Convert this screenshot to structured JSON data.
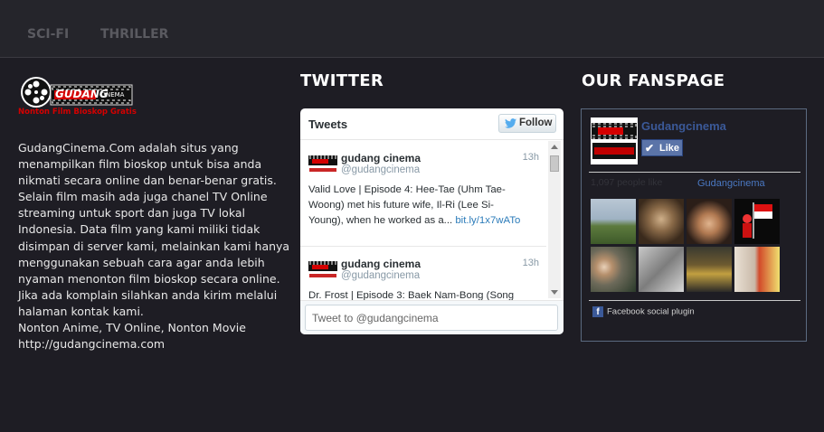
{
  "nav": {
    "items": [
      {
        "label": "SCI-FI"
      },
      {
        "label": "THRILLER"
      }
    ]
  },
  "logo": {
    "brand_text": "GUDANG CINEMA",
    "tagline": "Nonton Film Bioskop Gratis"
  },
  "about": {
    "lines": [
      "GudangCinema.Com adalah situs yang",
      "menampilkan film bioskop untuk bisa anda",
      "nikmati secara online dan benar-benar gratis.",
      "Selain film masih ada juga chanel TV Online",
      "streaming untuk sport dan juga TV lokal",
      "Indonesia. Data film yang kami miliki tidak",
      "disimpan di server kami, melainkan kami hanya",
      "menggunakan sebuah cara agar anda lebih",
      "nyaman menonton film bioskop secara online.",
      "Jika ada komplain silahkan anda kirim melalui",
      "halaman kontak kami.",
      "Nonton Anime, TV Online, Nonton Movie",
      "http://gudangcinema.com"
    ]
  },
  "twitter": {
    "heading": "TWITTER",
    "widget_title": "Tweets",
    "follow_label": "Follow",
    "tweets": [
      {
        "name": "gudang cinema",
        "handle": "@gudangcinema",
        "time": "13h",
        "text_lines": [
          "Valid Love | Episode 4: Hee-Tae (Uhm Tae-",
          "Woong) met his future wife, Il-Ri (Lee Si-",
          "Young), when he worked as a..."
        ],
        "link": "bit.ly/1x7wATo"
      },
      {
        "name": "gudang cinema",
        "handle": "@gudangcinema",
        "time": "13h",
        "text_lines": [
          "Dr. Frost | Episode 3: Baek Nam-Bong (Song"
        ],
        "link": ""
      }
    ],
    "compose_placeholder": "Tweet to @gudangcinema"
  },
  "fanspage": {
    "heading": "OUR FANSPAGE",
    "page_name": "Gudangcinema",
    "like_label": "Like",
    "likes_text": "1,097 people like",
    "likes_link": "Gudangcinema",
    "plugin_label": "Facebook social plugin"
  },
  "colors": {
    "background": "#1e1d24",
    "nav_bg": "#25252b",
    "link_blue": "#2b7bb9",
    "fb_blue": "#3b5998",
    "logo_red": "#d40000"
  }
}
